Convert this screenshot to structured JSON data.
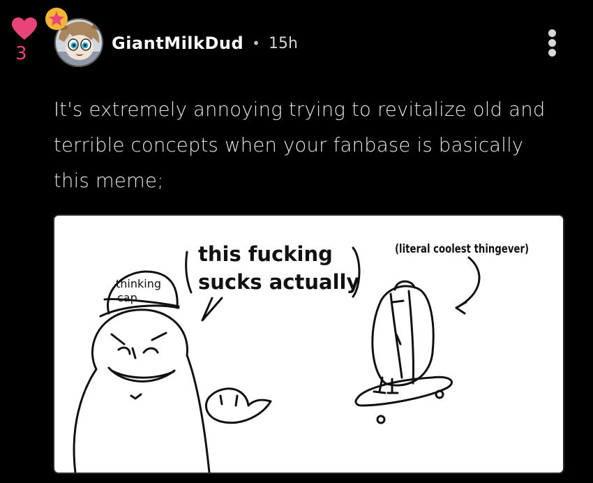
{
  "post": {
    "like_count": "3",
    "author": {
      "username": "GiantMilkDud",
      "time_ago": "15h"
    },
    "separator": "•",
    "body_lines": [
      "It's extremely annoying trying to revitalize old and",
      "terrible concepts when your fanbase is basically",
      "this meme;"
    ],
    "image": {
      "speech_line_1": "this fucking",
      "speech_line_2": "sucks actually",
      "cap_label_line_1": "thinking",
      "cap_label_line_2": "cap",
      "hotdog_caption": "(literal coolest thingever)"
    }
  },
  "icons": {
    "like": "heart-icon",
    "badge": "star-badge-icon",
    "menu": "more-vertical-icon"
  },
  "colors": {
    "background": "#000000",
    "accent_pink": "#e8447a",
    "badge_gold": "#f2b632",
    "text_primary": "#ffffff",
    "text_body": "#e6e6e6"
  }
}
